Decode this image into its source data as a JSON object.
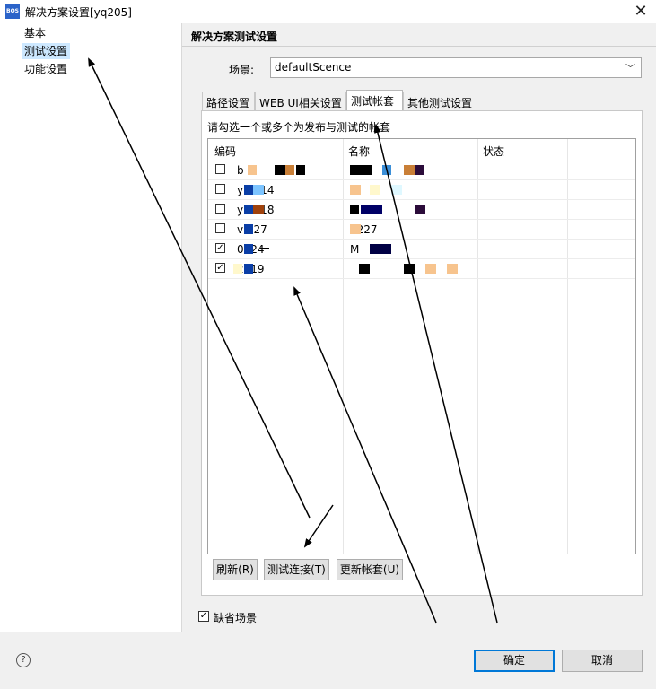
{
  "window": {
    "title": "解决方案设置[yq205]",
    "icon": "app-icon",
    "close": "✕"
  },
  "nav": {
    "items": [
      {
        "label": "基本",
        "selected": false
      },
      {
        "label": "测试设置",
        "selected": true
      },
      {
        "label": "功能设置",
        "selected": false
      }
    ]
  },
  "panel": {
    "title": "解决方案测试设置",
    "scene_label": "场景:",
    "scene_value": "defaultScence",
    "tabs": [
      {
        "label": "路径设置",
        "active": false
      },
      {
        "label": "WEB UI相关设置",
        "active": false
      },
      {
        "label": "测试帐套",
        "active": true
      },
      {
        "label": "其他测试设置",
        "active": false
      }
    ],
    "hint": "请勾选一个或多个为发布与测试的帐套",
    "columns": [
      "编码",
      "名称",
      "状态"
    ],
    "rows": [
      {
        "checked": false,
        "code": "b",
        "name": ""
      },
      {
        "checked": false,
        "code": "y   0114",
        "name": ""
      },
      {
        "checked": false,
        "code": "y   0218",
        "name": "s"
      },
      {
        "checked": false,
        "code": "v   227",
        "name": "0227"
      },
      {
        "checked": true,
        "code": "   0324",
        "name": "M"
      },
      {
        "checked": true,
        "code": "     2019",
        "name": ""
      }
    ],
    "buttons": {
      "refresh": "刷新(R)",
      "test_connection": "测试连接(T)",
      "update": "更新帐套(U)"
    },
    "default_scene": {
      "label": "缺省场景",
      "checked": true
    }
  },
  "footer": {
    "help": "?",
    "ok": "确定",
    "cancel": "取消"
  },
  "colors": {
    "selection": "#cde8ff",
    "ok_border": "#0078d7"
  }
}
